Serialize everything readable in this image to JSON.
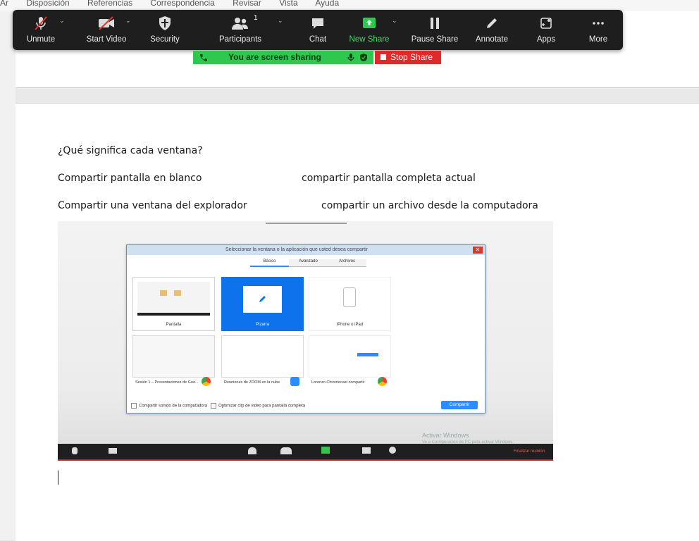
{
  "word": {
    "menu": [
      "Ar",
      "Disposición",
      "Referencias",
      "Correspondencia",
      "Revisar",
      "Vista",
      "Ayuda"
    ]
  },
  "zoom_toolbar": {
    "buttons": [
      {
        "label": "Unmute",
        "icon": "mic-muted-icon"
      },
      {
        "label": "Start Video",
        "icon": "video-off-icon"
      },
      {
        "label": "Security",
        "icon": "shield-icon"
      },
      {
        "label": "Participants",
        "icon": "participants-icon",
        "count": "1"
      },
      {
        "label": "Chat",
        "icon": "chat-icon"
      },
      {
        "label": "New Share",
        "icon": "share-arrow-icon"
      },
      {
        "label": "Pause Share",
        "icon": "pause-icon"
      },
      {
        "label": "Annotate",
        "icon": "pencil-icon"
      },
      {
        "label": "Apps",
        "icon": "apps-icon"
      },
      {
        "label": "More",
        "icon": "more-dots-icon"
      }
    ],
    "sharing_banner": "You are screen sharing",
    "stop_share": "Stop Share"
  },
  "document": {
    "question": "¿Qué significa cada ventana?",
    "line1_left": "Compartir pantalla en blanco",
    "line1_right": "compartir pantalla completa actual",
    "line2_left": "Compartir una ventana del explorador",
    "line2_right": "compartir un archivo desde la computadora"
  },
  "embedded_dialog": {
    "title": "Seleccionar la ventana o la aplicación que usted desea compartir",
    "tabs": [
      "Básico",
      "Avanzado",
      "Archivos"
    ],
    "tiles": [
      "Pantalla",
      "Pizarra",
      "iPhone o iPad"
    ],
    "windows": [
      "Sesión 1 – Presentaciones de Goo...",
      "Reuniones de ZOOM en la nube",
      "Lorenzo Chromecast compartir"
    ],
    "footer_option1": "Compartir sonido de la computadora",
    "footer_option2": "Optimizar clip de video para pantalla completa",
    "share_button": "Compartir",
    "watermark": "Activar Windows",
    "watermark_sub": "Ve a Configuración de PC para activar Windows.",
    "end_meeting": "Finalizar reunión"
  },
  "colors": {
    "toolbar_bg": "#1e1e1e",
    "share_green": "#2ec84e",
    "stop_red": "#e02a2a",
    "zoom_blue": "#0e72ed"
  }
}
